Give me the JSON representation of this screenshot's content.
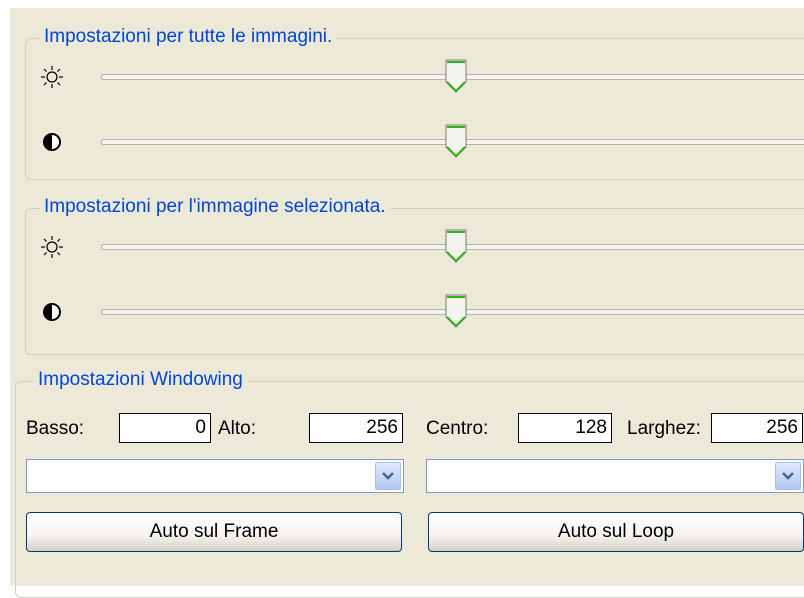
{
  "groups": {
    "all_images": {
      "title": "Impostazioni per tutte le immagini."
    },
    "selected_image": {
      "title": "Impostazioni per l'immagine selezionata."
    },
    "windowing": {
      "title": "Impostazioni Windowing"
    }
  },
  "sliders": {
    "all_brightness": {
      "icon": "brightness-icon",
      "level_pct": 50
    },
    "all_contrast": {
      "icon": "contrast-icon",
      "level_pct": 50
    },
    "sel_brightness": {
      "icon": "brightness-icon",
      "level_pct": 50
    },
    "sel_contrast": {
      "icon": "contrast-icon",
      "level_pct": 50
    }
  },
  "windowing": {
    "basso_label": "Basso:",
    "basso_value": "0",
    "alto_label": "Alto:",
    "alto_value": "256",
    "centro_label": "Centro:",
    "centro_value": "128",
    "larghezza_label": "Larghez:",
    "larghezza_value": "256",
    "combo_left_value": "",
    "combo_right_value": "",
    "auto_frame_label": "Auto sul Frame",
    "auto_loop_label": "Auto sul Loop"
  },
  "colors": {
    "legend_text": "#0046d5",
    "panel_bg": "#ece9d8",
    "thumb_accent": "#2fb41b"
  }
}
